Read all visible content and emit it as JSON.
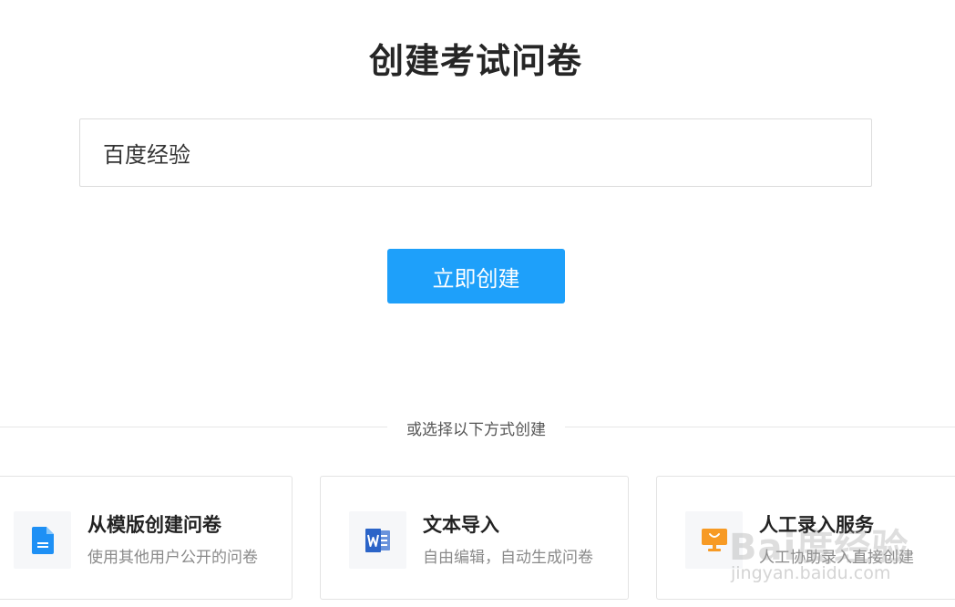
{
  "page": {
    "title": "创建考试问卷"
  },
  "form": {
    "name_value": "百度经验",
    "create_button_label": "立即创建"
  },
  "divider": {
    "label": "或选择以下方式创建"
  },
  "cards": [
    {
      "title": "从模版创建问卷",
      "description": "使用其他用户公开的问卷",
      "icon": "document-icon",
      "icon_color": "#1e90f5"
    },
    {
      "title": "文本导入",
      "description": "自由编辑，自动生成问卷",
      "icon": "word-icon",
      "icon_color": "#2b64c8"
    },
    {
      "title": "人工录入服务",
      "description": "人工协助录入直接创建",
      "icon": "service-icon",
      "icon_color": "#f79a24"
    }
  ],
  "watermark": {
    "logo_text": "Bai度经验",
    "url_text": "jingyan.baidu.com"
  },
  "colors": {
    "primary": "#1ea0fa",
    "border": "#dcdcdc",
    "muted_text": "#8a8a8a"
  }
}
